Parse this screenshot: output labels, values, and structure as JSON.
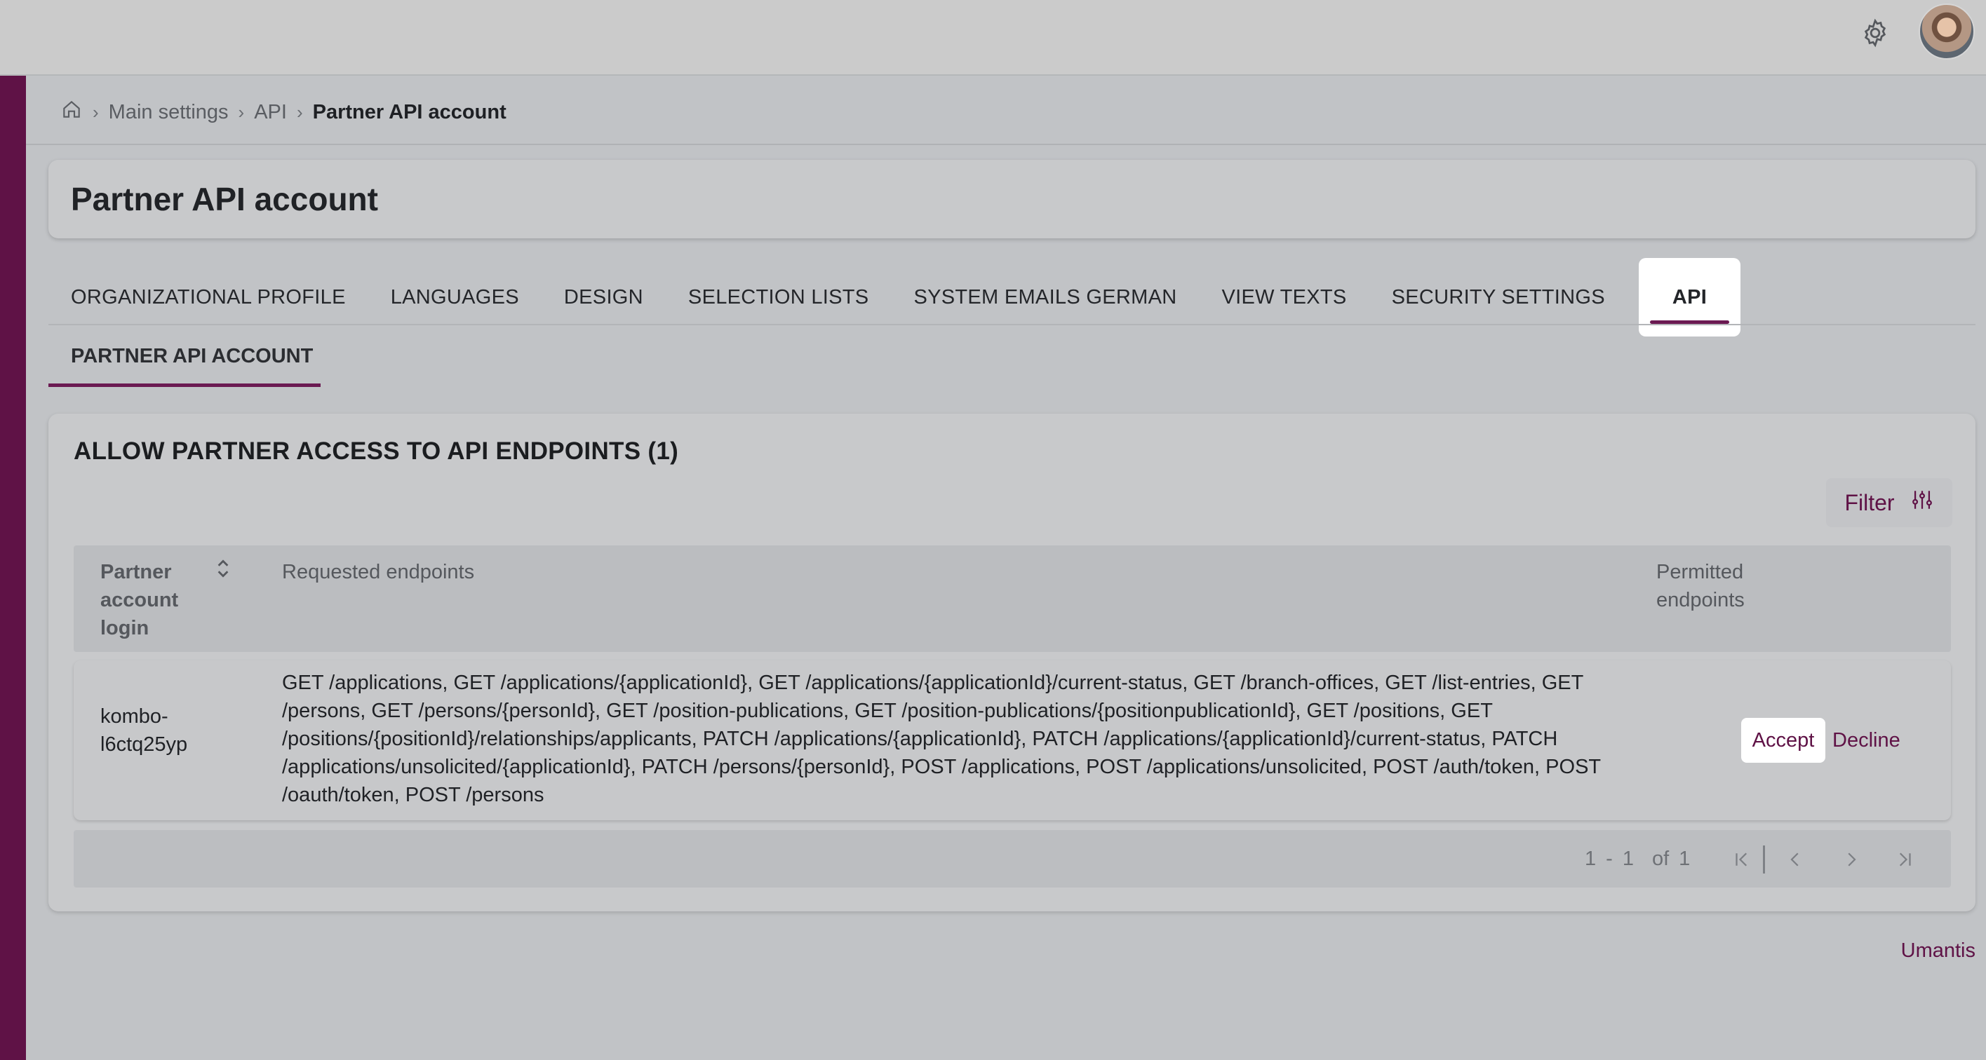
{
  "header": {
    "settings_icon": "gear-icon",
    "avatar_icon": "user-avatar"
  },
  "breadcrumb": {
    "home_icon": "home-icon",
    "items": [
      "Main settings",
      "API"
    ],
    "current": "Partner API account"
  },
  "page": {
    "title": "Partner API account"
  },
  "tabs": [
    {
      "label": "ORGANIZATIONAL PROFILE"
    },
    {
      "label": "LANGUAGES"
    },
    {
      "label": "DESIGN"
    },
    {
      "label": "SELECTION LISTS"
    },
    {
      "label": "SYSTEM EMAILS GERMAN"
    },
    {
      "label": "VIEW TEXTS"
    },
    {
      "label": "SECURITY SETTINGS"
    },
    {
      "label": "API",
      "active": true
    }
  ],
  "subtab": {
    "label": "PARTNER API ACCOUNT"
  },
  "panel": {
    "title": "ALLOW PARTNER ACCESS TO API ENDPOINTS (1)",
    "filter_label": "Filter",
    "filter_icon": "sliders-icon"
  },
  "table": {
    "columns": {
      "login": "Partner account login",
      "requested": "Requested endpoints",
      "permitted": "Permitted endpoints"
    },
    "rows": [
      {
        "login": "kombo-l6ctq25yp",
        "requested": "GET /applications, GET /applications/{applicationId}, GET /applications/{applicationId}/current-status, GET /branch-offices, GET /list-entries, GET /persons, GET /persons/{personId}, GET /position-publications, GET /position-publications/{positionpublicationId}, GET /positions, GET /positions/{positionId}/relationships/applicants, PATCH /applications/{applicationId}, PATCH /applications/{applicationId}/current-status, PATCH /applications/unsolicited/{applicationId}, PATCH /persons/{personId}, POST /applications, POST /applications/unsolicited, POST /auth/token, POST /oauth/token, POST /persons",
        "permitted": "",
        "accept_label": "Accept",
        "decline_label": "Decline"
      }
    ]
  },
  "pagination": {
    "from": "1",
    "dash": "-",
    "to": "1",
    "of_label": "of",
    "total": "1"
  },
  "footer": {
    "brand": "Umantis"
  },
  "colors": {
    "accent": "#5f1246",
    "sidebar": "#5f1246",
    "background": "#c1c3c6"
  }
}
